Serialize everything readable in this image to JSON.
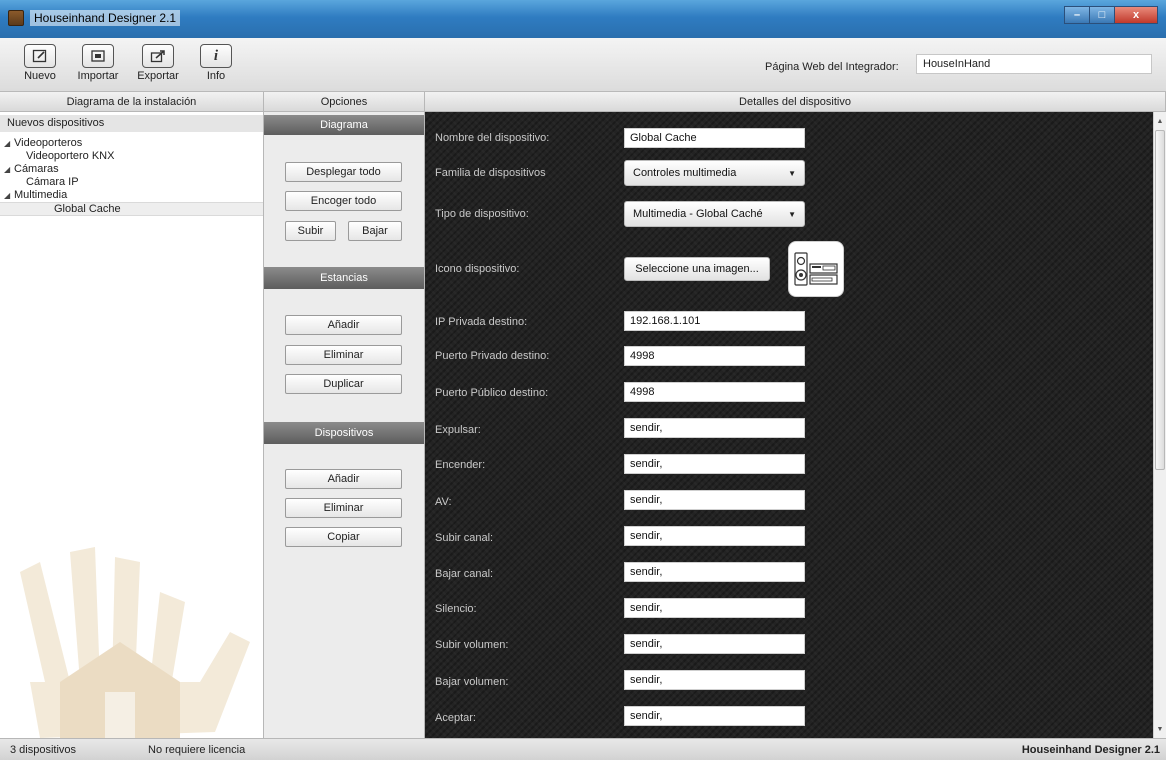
{
  "window": {
    "title": "Houseinhand Designer 2.1",
    "controls": {
      "minimize": "–",
      "maximize": "□",
      "close": "x"
    }
  },
  "toolbar": {
    "tools": [
      {
        "label": "Nuevo",
        "icon": "edit-icon"
      },
      {
        "label": "Importar",
        "icon": "import-icon"
      },
      {
        "label": "Exportar",
        "icon": "export-icon"
      },
      {
        "label": "Info",
        "icon": "info-icon"
      }
    ],
    "web_label": "Página Web del Integrador:",
    "web_value": "HouseInHand"
  },
  "columns": {
    "tree": "Diagrama de la instalación",
    "options": "Opciones",
    "details": "Detalles del dispositivo"
  },
  "tree": {
    "header": "Nuevos dispositivos",
    "items": [
      {
        "label": "Videoporteros",
        "level": 0,
        "expanded": true
      },
      {
        "label": "Videoportero KNX",
        "level": 1
      },
      {
        "label": "Cámaras",
        "level": 0,
        "expanded": true
      },
      {
        "label": "Cámara IP",
        "level": 1
      },
      {
        "label": "Multimedia",
        "level": 0,
        "expanded": true
      },
      {
        "label": "Global Cache",
        "level": 1,
        "selected": true
      }
    ]
  },
  "options": {
    "diagram": {
      "title": "Diagrama",
      "expand_all": "Desplegar todo",
      "collapse_all": "Encoger todo",
      "up": "Subir",
      "down": "Bajar"
    },
    "rooms": {
      "title": "Estancias",
      "add": "Añadir",
      "delete": "Eliminar",
      "duplicate": "Duplicar"
    },
    "devices": {
      "title": "Dispositivos",
      "add": "Añadir",
      "delete": "Eliminar",
      "copy": "Copiar"
    }
  },
  "details": {
    "name_label": "Nombre del dispositivo:",
    "name_value": "Global Cache",
    "family_label": "Familia de dispositivos",
    "family_value": "Controles multimedia",
    "type_label": "Tipo de dispositivo:",
    "type_value": "Multimedia - Global Caché",
    "icon_label": "Icono dispositivo:",
    "icon_button": "Seleccione una imagen...",
    "ip_label": "IP Privada destino:",
    "ip_value": "192.168.1.101",
    "private_port_label": "Puerto Privado destino:",
    "private_port_value": "4998",
    "public_port_label": "Puerto Público destino:",
    "public_port_value": "4998",
    "commands": [
      {
        "label": "Expulsar:",
        "value": "sendir,"
      },
      {
        "label": "Encender:",
        "value": "sendir,"
      },
      {
        "label": "AV:",
        "value": "sendir,"
      },
      {
        "label": "Subir canal:",
        "value": "sendir,"
      },
      {
        "label": "Bajar canal:",
        "value": "sendir,"
      },
      {
        "label": "Silencio:",
        "value": "sendir,"
      },
      {
        "label": "Subir volumen:",
        "value": "sendir,"
      },
      {
        "label": "Bajar volumen:",
        "value": "sendir,"
      },
      {
        "label": "Aceptar:",
        "value": "sendir,"
      }
    ]
  },
  "status": {
    "count": "3 dispositivos",
    "license": "No requiere licencia",
    "brand": "Houseinhand Designer 2.1"
  }
}
